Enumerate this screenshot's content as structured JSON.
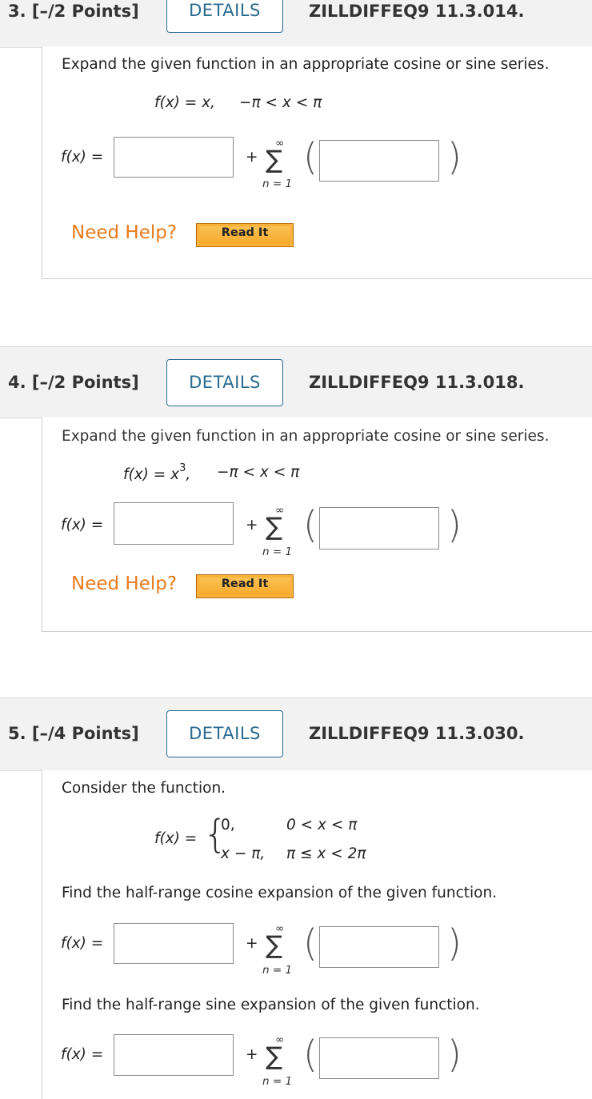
{
  "q3": {
    "number": "3.  [–/2 Points]",
    "details": "DETAILS",
    "code": "ZILLDIFFEQ9 11.3.014.",
    "prompt": "Expand the given function in an appropriate cosine or sine series.",
    "func_lhs": "f(x) = x,",
    "func_range": "−π < x < π",
    "answer_lhs": "f(x) =",
    "plus": "+",
    "sum_top": "∞",
    "sum_symbol": "∑",
    "sum_bottom": "n = 1",
    "need_help": "Need Help?",
    "read_it": "Read It"
  },
  "q4": {
    "number": "4.  [–/2 Points]",
    "details": "DETAILS",
    "code": "ZILLDIFFEQ9 11.3.018.",
    "prompt": "Expand the given function in an appropriate cosine or sine series.",
    "func_lhs": "f(x) = x",
    "func_exp": "3",
    "func_comma": ",",
    "func_range": "−π < x < π",
    "answer_lhs": "f(x) =",
    "plus": "+",
    "sum_top": "∞",
    "sum_symbol": "∑",
    "sum_bottom": "n = 1",
    "need_help": "Need Help?",
    "read_it": "Read It"
  },
  "q5": {
    "number": "5.  [–/4 Points]",
    "details": "DETAILS",
    "code": "ZILLDIFFEQ9 11.3.030.",
    "prompt": "Consider the function.",
    "func_lhs": "f(x) =",
    "case1_value": "0,",
    "case1_cond": "0  <  x  <  π",
    "case2_value": "x − π,",
    "case2_cond": "π ≤  x  <  2π",
    "part1_prompt": "Find the half-range cosine expansion of the given function.",
    "part2_prompt": "Find the half-range sine expansion of the given function.",
    "answer_lhs": "f(x) =",
    "plus": "+",
    "sum_top": "∞",
    "sum_symbol": "∑",
    "sum_bottom": "n = 1"
  }
}
